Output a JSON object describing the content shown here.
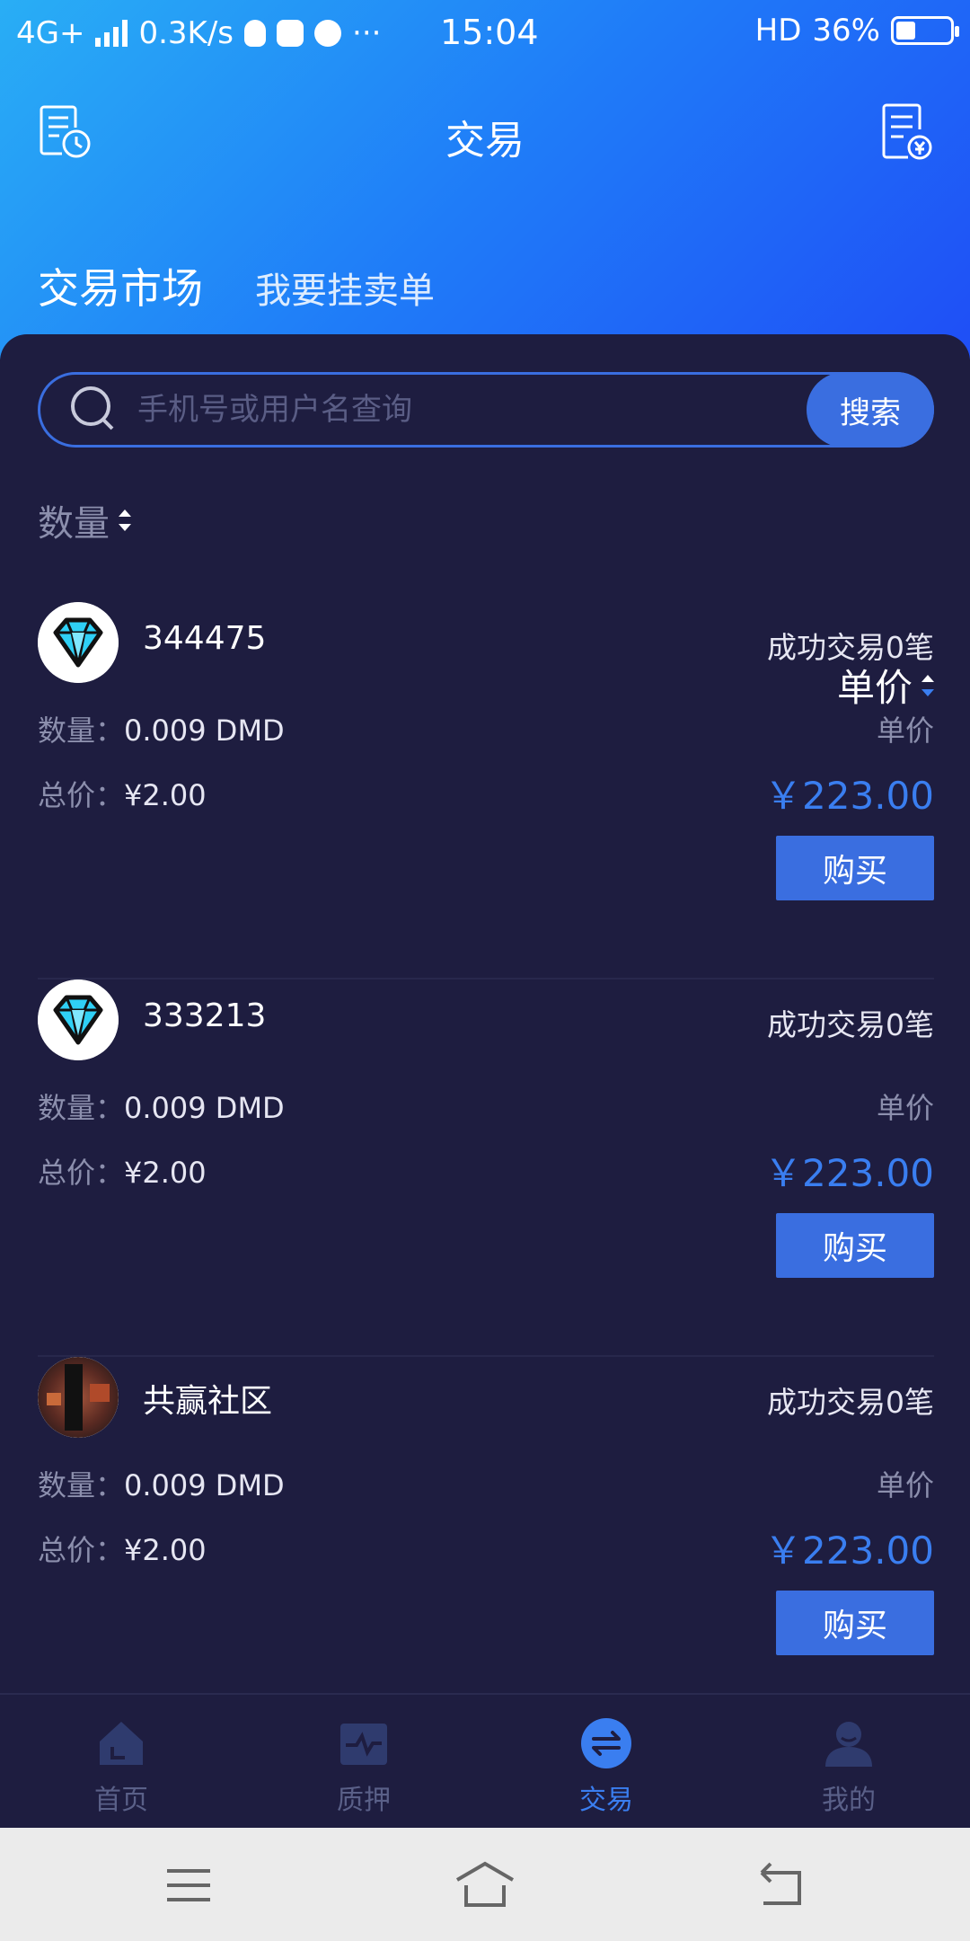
{
  "status_bar": {
    "network": "4G+",
    "speed": "0.3K/s",
    "more": "···",
    "time": "15:04",
    "hd": "HD",
    "battery": "36%",
    "battery_level": 0.36
  },
  "nav": {
    "title": "交易",
    "left_icon": "order-history-icon",
    "right_icon": "bill-icon"
  },
  "tabs": {
    "market": "交易市场",
    "sell": "我要挂卖单"
  },
  "search": {
    "placeholder": "手机号或用户名查询",
    "button": "搜索"
  },
  "sort": {
    "quantity": "数量",
    "unit_price": "单价"
  },
  "listings": [
    {
      "user": "344475",
      "avatar": "diamond",
      "success": "成功交易0笔",
      "qty_label": "数量：",
      "qty": "0.009 DMD",
      "total_label": "总价：",
      "total": "¥2.00",
      "unit_label": "单价",
      "price": "￥223.00",
      "buy": "购买"
    },
    {
      "user": "333213",
      "avatar": "diamond",
      "success": "成功交易0笔",
      "qty_label": "数量：",
      "qty": "0.009 DMD",
      "total_label": "总价：",
      "total": "¥2.00",
      "unit_label": "单价",
      "price": "￥223.00",
      "buy": "购买"
    },
    {
      "user": "共赢社区",
      "avatar": "photo",
      "success": "成功交易0笔",
      "qty_label": "数量：",
      "qty": "0.009 DMD",
      "total_label": "总价：",
      "total": "¥2.00",
      "unit_label": "单价",
      "price": "￥223.00",
      "buy": "购买"
    }
  ],
  "tabbar": [
    {
      "label": "首页",
      "icon": "home-icon"
    },
    {
      "label": "质押",
      "icon": "pledge-icon"
    },
    {
      "label": "交易",
      "icon": "exchange-icon",
      "active": true
    },
    {
      "label": "我的",
      "icon": "profile-icon"
    }
  ],
  "colors": {
    "accent": "#3a7ef0",
    "background": "#1e1d40",
    "header_gradient_start": "#29aef5",
    "header_gradient_end": "#1f4ef6"
  }
}
